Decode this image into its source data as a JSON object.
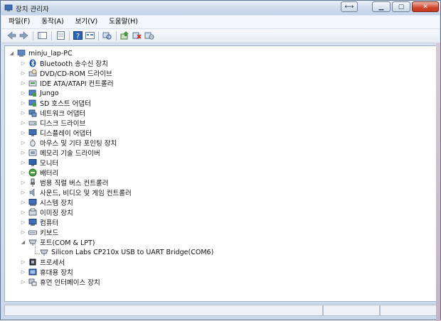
{
  "window": {
    "title": "장치 관리자"
  },
  "menu": [
    "파일(F)",
    "동작(A)",
    "보기(V)",
    "도움말(H)"
  ],
  "toolbar_icons": [
    "back-arrow-icon",
    "forward-arrow-icon",
    "show-hide-tree-icon",
    "properties-icon",
    "help-icon",
    "view-icon",
    "scan-hardware-icon",
    "update-driver-icon",
    "uninstall-icon",
    "disable-icon"
  ],
  "tree": {
    "root": "minju_lap-PC",
    "items": [
      {
        "label": "Bluetooth 송수신 장치",
        "icon": "bluetooth-icon"
      },
      {
        "label": "DVD/CD-ROM 드라이브",
        "icon": "dvd-drive-icon"
      },
      {
        "label": "IDE ATA/ATAPI 컨트롤러",
        "icon": "ide-controller-icon"
      },
      {
        "label": "Jungo",
        "icon": "jungo-icon"
      },
      {
        "label": "SD 호스트 어댑터",
        "icon": "sd-host-icon"
      },
      {
        "label": "네트워크 어댑터",
        "icon": "network-adapter-icon"
      },
      {
        "label": "디스크 드라이브",
        "icon": "disk-drive-icon"
      },
      {
        "label": "디스플레이 어댑터",
        "icon": "display-adapter-icon"
      },
      {
        "label": "마우스 및 기타 포인팅 장치",
        "icon": "mouse-icon"
      },
      {
        "label": "메모리 기술 드라이버",
        "icon": "memory-icon"
      },
      {
        "label": "모니터",
        "icon": "monitor-icon"
      },
      {
        "label": "배터리",
        "icon": "battery-icon"
      },
      {
        "label": "범용 직렬 버스 컨트롤러",
        "icon": "usb-controller-icon"
      },
      {
        "label": "사운드, 비디오 및 게임 컨트롤러",
        "icon": "sound-icon"
      },
      {
        "label": "시스템 장치",
        "icon": "system-device-icon"
      },
      {
        "label": "이미징 장치",
        "icon": "imaging-device-icon"
      },
      {
        "label": "컴퓨터",
        "icon": "computer-icon"
      },
      {
        "label": "키보드",
        "icon": "keyboard-icon"
      },
      {
        "label": "포트(COM & LPT)",
        "icon": "port-icon",
        "expanded": true,
        "children": [
          {
            "label": "Silicon Labs CP210x USB to UART Bridge(COM6)",
            "icon": "port-device-icon"
          }
        ]
      },
      {
        "label": "프로세서",
        "icon": "processor-icon"
      },
      {
        "label": "휴대용 장치",
        "icon": "portable-device-icon"
      },
      {
        "label": "휴먼 인터페이스 장치",
        "icon": "hid-icon"
      }
    ]
  }
}
